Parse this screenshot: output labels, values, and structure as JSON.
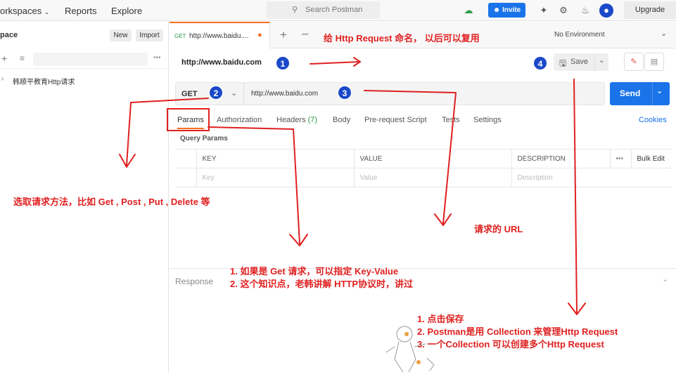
{
  "topbar": {
    "workspaces": "orkspaces",
    "reports": "Reports",
    "explore": "Explore",
    "search_placeholder": "Search Postman",
    "invite": "Invite",
    "upgrade": "Upgrade"
  },
  "sidebar": {
    "title": "pace",
    "new_label": "New",
    "import_label": "Import",
    "collection_name": "韩顺平教育Http请求"
  },
  "tab": {
    "method": "GET",
    "title": "http://www.baidu....",
    "environment": "No Environment"
  },
  "request": {
    "name": "http://www.baidu.com",
    "method": "GET",
    "url": "http://www.baidu.com",
    "save_label": "Save",
    "send_label": "Send"
  },
  "subtabs": {
    "params": "Params",
    "authorization": "Authorization",
    "headers": "Headers",
    "headers_count": "(7)",
    "body": "Body",
    "prerequest": "Pre-request Script",
    "tests": "Tests",
    "settings": "Settings",
    "cookies": "Cookies"
  },
  "params": {
    "section_title": "Query Params",
    "col_key": "KEY",
    "col_value": "VALUE",
    "col_description": "DESCRIPTION",
    "bulk_edit": "Bulk Edit",
    "key_placeholder": "Key",
    "value_placeholder": "Value",
    "description_placeholder": "Description"
  },
  "response": {
    "label": "Response"
  },
  "annotations": {
    "name_note": "给 Http Request 命名， 以后可以复用",
    "method_note": "选取请求方法，比如 Get , Post , Put , Delete 等",
    "url_note": "请求的 URL",
    "kv_note_1": "1. 如果是 Get 请求，可以指定 Key-Value",
    "kv_note_2": "2. 这个知识点，老韩讲解 HTTP协议时，讲过",
    "save_note_1": "1. 点击保存",
    "save_note_2": "2. Postman是用 Collection 来管理Http Request",
    "save_note_3": "3. 一个Collection 可以创建多个Http Request",
    "c1": "1",
    "c2": "2",
    "c3": "3",
    "c4": "4"
  },
  "colors": {
    "accent": "#1a73e8",
    "annotation": "#e02020",
    "tab_indicator": "#f37021",
    "badge": "#1a49c9"
  }
}
